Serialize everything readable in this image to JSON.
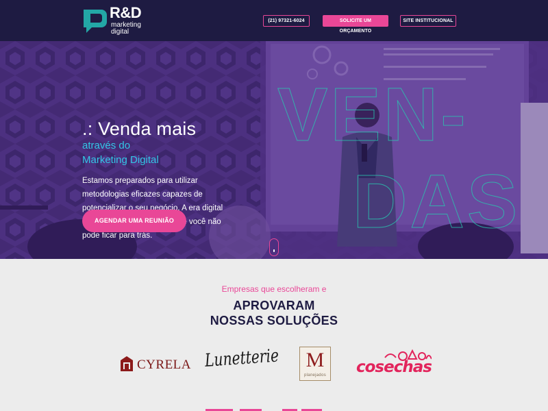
{
  "header": {
    "logo": {
      "title": "R&D",
      "sub1": "marketing",
      "sub2": "digital"
    },
    "phone_button": "(21) 97321-6024",
    "quote_button": "SOLICITE UM ORÇAMENTO",
    "site_button": "SITE INSTITUCIONAL"
  },
  "hero": {
    "title": ".: Venda mais",
    "subtitle_line1": "através do",
    "subtitle_line2": "Marketing Digital",
    "description": "Estamos preparados para utilizar metodologias eficazes capazes de potencializar o seu negócio. A era digital está em constante evolução e você não pode ficar para trás.",
    "cta": "AGENDAR UMA REUNIÃO",
    "watermark_line1": "VEN-",
    "watermark_line2": "DAS"
  },
  "clients": {
    "kicker": "Empresas que escolheram e",
    "title_line1": "APROVARAM",
    "title_line2": "NOSSAS SOLUÇÕES",
    "logos": [
      {
        "name": "CYRELA"
      },
      {
        "name": "Lunetterie"
      },
      {
        "name": "M",
        "sub": "planejados"
      },
      {
        "name": "cosechas"
      }
    ]
  },
  "colors": {
    "navy": "#1e1b42",
    "pink": "#e94797",
    "cyan": "#33c6e6",
    "light": "#ececec"
  }
}
